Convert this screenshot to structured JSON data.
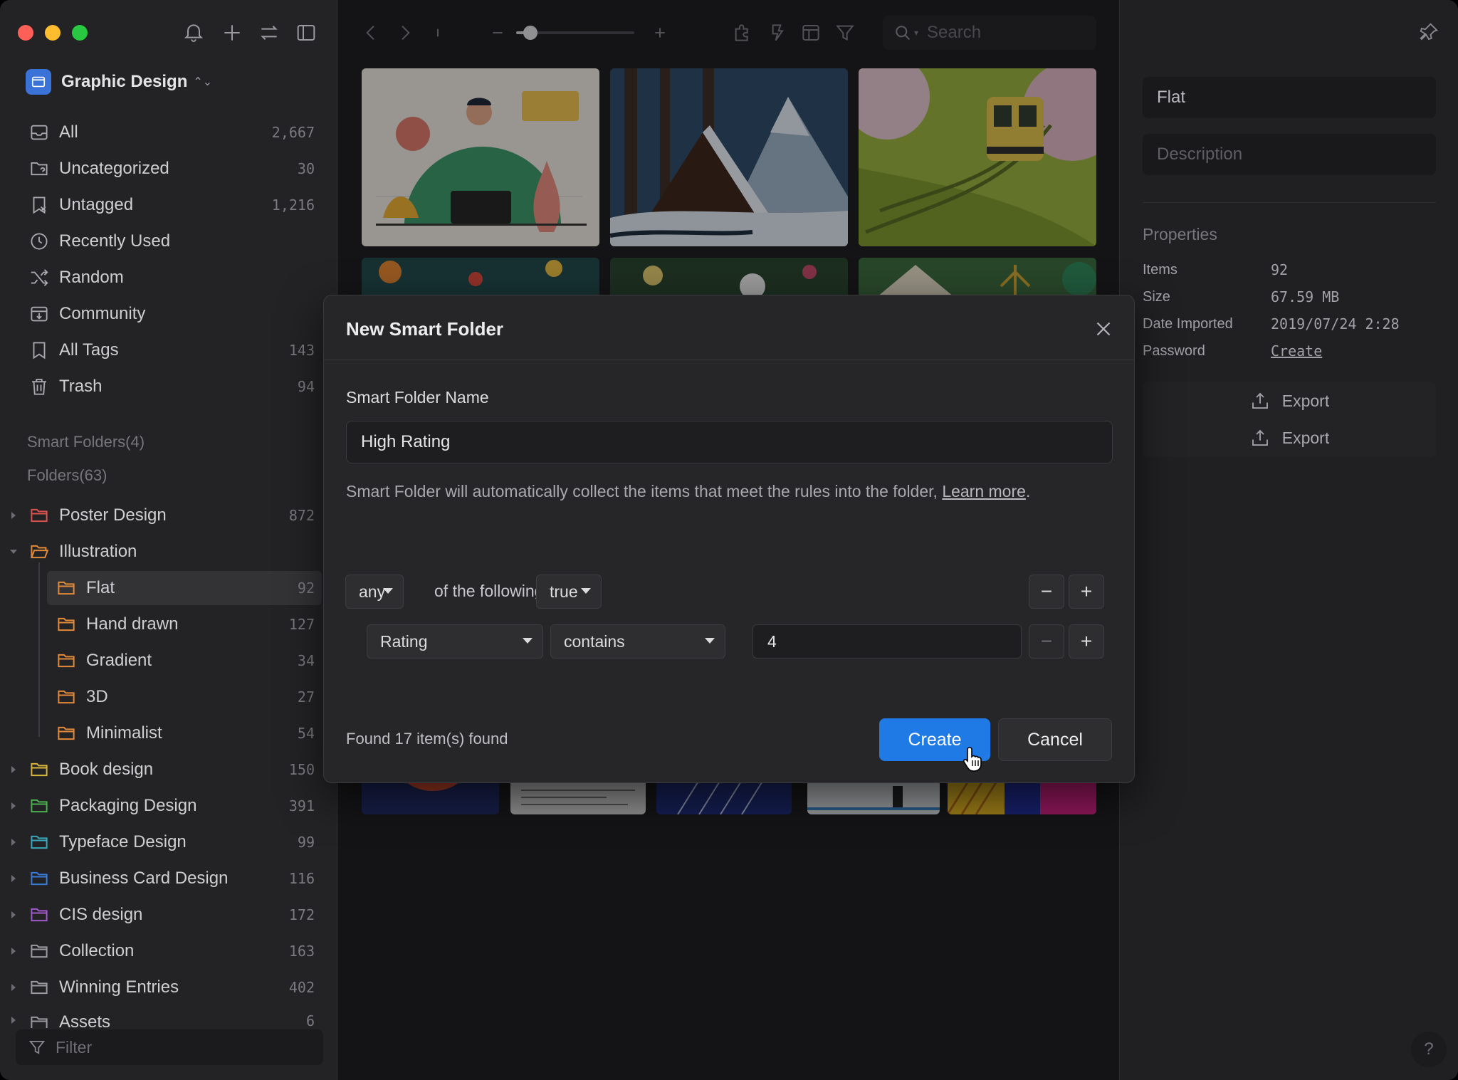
{
  "sidebar": {
    "library_name": "Graphic Design",
    "nav": [
      {
        "label": "All",
        "count": "2,667",
        "icon": "inbox-icon"
      },
      {
        "label": "Uncategorized",
        "count": "30",
        "icon": "folder-question-icon"
      },
      {
        "label": "Untagged",
        "count": "1,216",
        "icon": "tag-off-icon"
      },
      {
        "label": "Recently Used",
        "count": "",
        "icon": "clock-icon"
      },
      {
        "label": "Random",
        "count": "",
        "icon": "shuffle-icon"
      },
      {
        "label": "Community",
        "count": "",
        "icon": "download-box-icon"
      },
      {
        "label": "All Tags",
        "count": "143",
        "icon": "bookmark-icon"
      },
      {
        "label": "Trash",
        "count": "94",
        "icon": "trash-icon"
      }
    ],
    "smart_folders_header": "Smart Folders(4)",
    "folders_header": "Folders(63)",
    "folders": [
      {
        "label": "Poster Design",
        "count": "872",
        "color": "#d9534f"
      },
      {
        "label": "Illustration",
        "count": "",
        "color": "#e08a3a"
      },
      {
        "label": "Flat",
        "count": "92",
        "color": "#e08a3a"
      },
      {
        "label": "Hand drawn",
        "count": "127",
        "color": "#e08a3a"
      },
      {
        "label": "Gradient",
        "count": "34",
        "color": "#e08a3a"
      },
      {
        "label": "3D",
        "count": "27",
        "color": "#e08a3a"
      },
      {
        "label": "Minimalist",
        "count": "54",
        "color": "#e08a3a"
      },
      {
        "label": "Book design",
        "count": "150",
        "color": "#d8b43a"
      },
      {
        "label": "Packaging Design",
        "count": "391",
        "color": "#4caf50"
      },
      {
        "label": "Typeface Design",
        "count": "99",
        "color": "#3aa6b9"
      },
      {
        "label": "Business Card Design",
        "count": "116",
        "color": "#3a7bd5"
      },
      {
        "label": "CIS design",
        "count": "172",
        "color": "#a05ad0"
      },
      {
        "label": "Collection",
        "count": "163",
        "color": "#9a9aa0"
      },
      {
        "label": "Winning Entries",
        "count": "402",
        "color": "#9a9aa0"
      },
      {
        "label": "Assets",
        "count": "6",
        "color": "#9a9aa0"
      }
    ],
    "filter_placeholder": "Filter"
  },
  "toolbar": {
    "search_placeholder": "Search",
    "zoom_level": 0.12
  },
  "right_panel": {
    "name": "Flat",
    "description_placeholder": "Description",
    "properties_title": "Properties",
    "properties": [
      {
        "key": "Items",
        "value": "92"
      },
      {
        "key": "Size",
        "value": "67.59 MB"
      },
      {
        "key": "Date Imported",
        "value": "2019/07/24 2:28"
      },
      {
        "key": "Password",
        "value": "Create"
      }
    ],
    "export_1": "Export",
    "export_2": "Export",
    "help": "?"
  },
  "dialog": {
    "title": "New Smart Folder",
    "name_label": "Smart Folder Name",
    "name_value": "High Rating",
    "description": "Smart Folder will automatically collect the items that meet the rules into the folder, ",
    "learn_more": "Learn more",
    "learn_more_suffix": ".",
    "match_mode": "any",
    "match_text": "of the following are",
    "match_bool": "true",
    "rule_field": "Rating",
    "rule_operator": "contains",
    "rule_value": "4",
    "found_text": "Found 17 item(s) found",
    "create_label": "Create",
    "cancel_label": "Cancel",
    "minus": "−",
    "plus": "+"
  }
}
